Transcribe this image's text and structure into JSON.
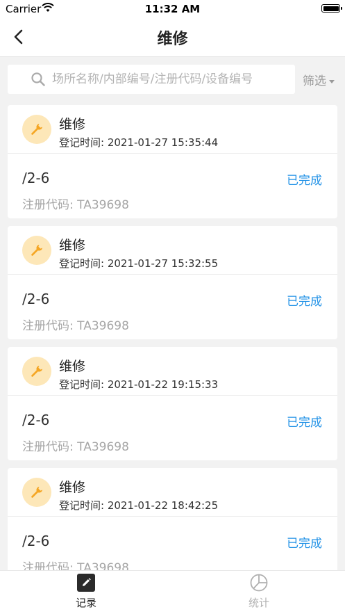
{
  "status_bar": {
    "carrier": "Carrier",
    "time": "11:32 AM"
  },
  "nav": {
    "title": "维修",
    "back_icon": "chevron-left-icon"
  },
  "search": {
    "placeholder": "场所名称/内部编号/注册代码/设备编号",
    "value": "",
    "filter_label": "筛选"
  },
  "colors": {
    "status_done": "#1e90e6",
    "icon_bg": "#fde7b8",
    "icon_fg": "#f5a623"
  },
  "records": [
    {
      "type": "维修",
      "time_label": "登记时间: 2021-01-27 15:35:44",
      "location": "/2-6",
      "status": "已完成",
      "code_label": "注册代码: TA39698",
      "icon": "wrench-icon"
    },
    {
      "type": "维修",
      "time_label": "登记时间: 2021-01-27 15:32:55",
      "location": "/2-6",
      "status": "已完成",
      "code_label": "注册代码: TA39698",
      "icon": "wrench-icon"
    },
    {
      "type": "维修",
      "time_label": "登记时间: 2021-01-22 19:15:33",
      "location": "/2-6",
      "status": "已完成",
      "code_label": "注册代码: TA39698",
      "icon": "wrench-icon"
    },
    {
      "type": "维修",
      "time_label": "登记时间: 2021-01-22 18:42:25",
      "location": "/2-6",
      "status": "已完成",
      "code_label": "注册代码: TA39698",
      "icon": "wrench-icon"
    }
  ],
  "tabs": [
    {
      "label": "记录",
      "icon": "edit-icon",
      "active": true
    },
    {
      "label": "统计",
      "icon": "pie-chart-icon",
      "active": false
    }
  ]
}
